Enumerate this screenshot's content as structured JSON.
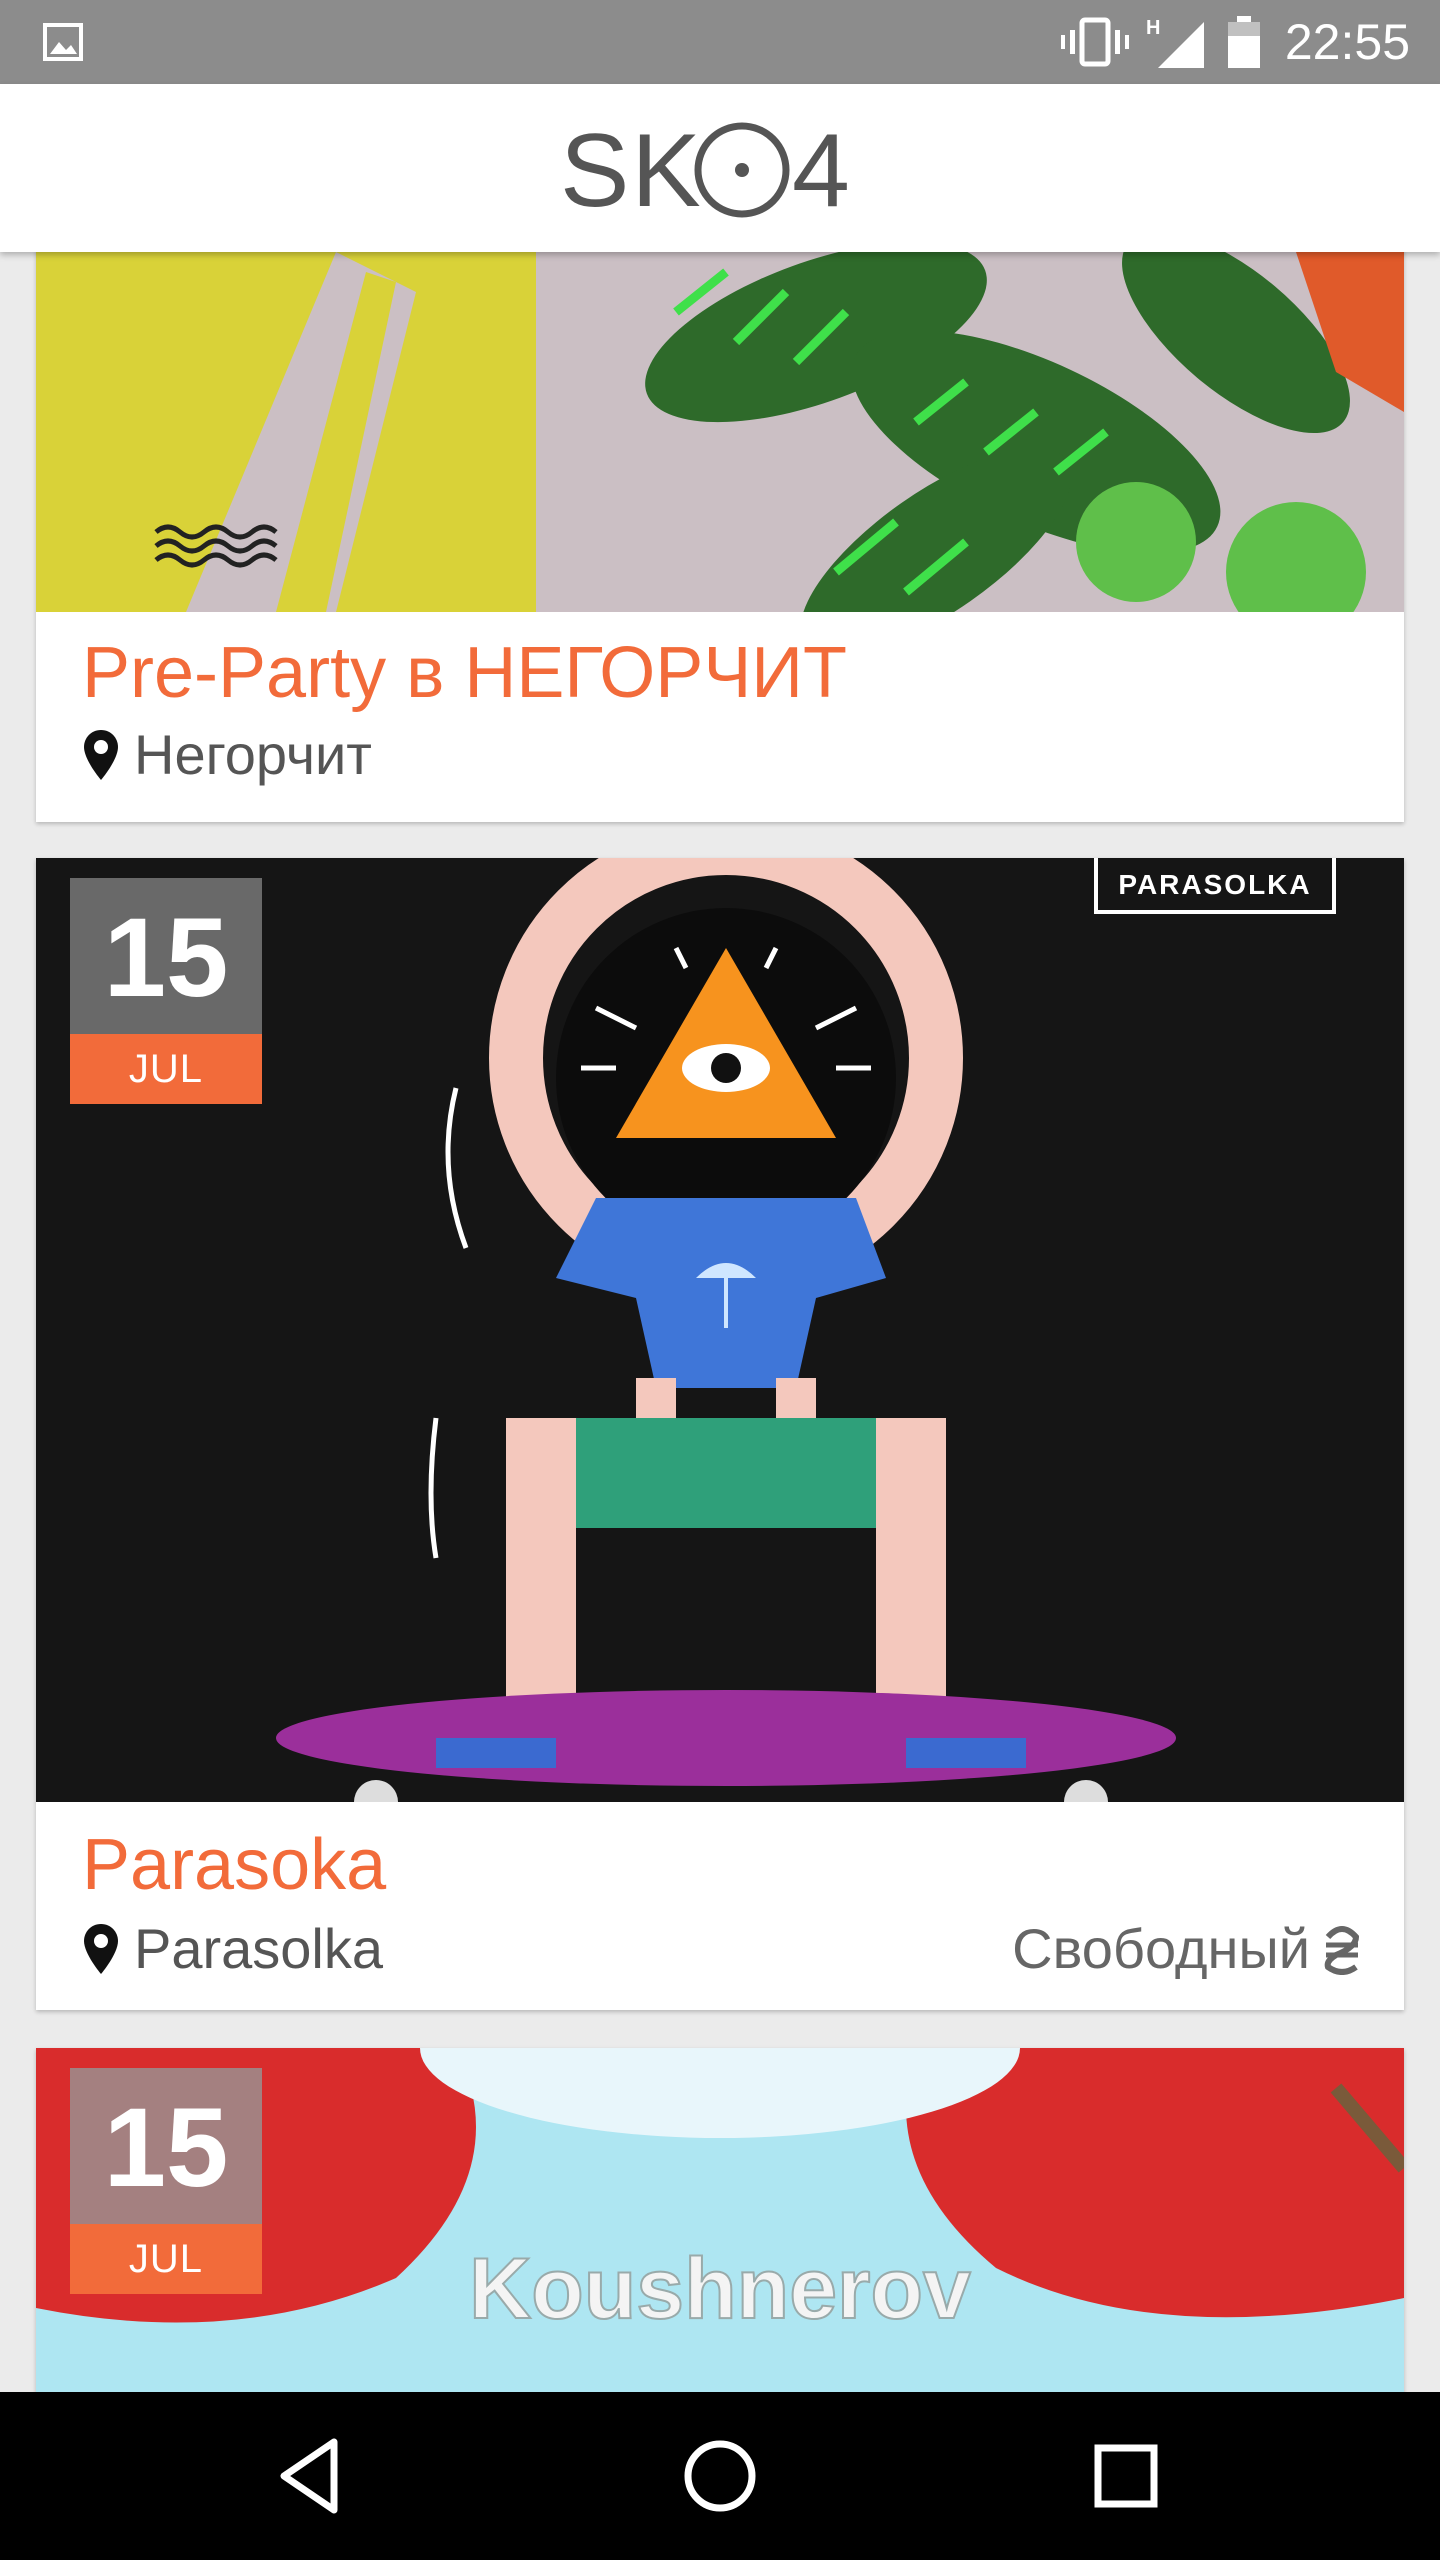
{
  "status_bar": {
    "time": "22:55",
    "network_label": "H",
    "icons": [
      "image-icon",
      "vibrate-icon",
      "signal-icon",
      "battery-icon"
    ]
  },
  "app_bar": {
    "logo_text": "SKO4"
  },
  "colors": {
    "accent": "#f26b3a",
    "status_bar": "#8c8c8c",
    "nav_bar": "#000000",
    "venue_text": "#555555"
  },
  "cards": [
    {
      "title": "Pre-Party в НЕГОРЧИТ",
      "venue": "Негорчит",
      "venue_icon": "location-pin-icon"
    },
    {
      "title": "Parasoka",
      "venue": "Parasolka",
      "venue_icon": "location-pin-icon",
      "price": "Свободный",
      "price_icon": "hryvnia-icon",
      "date": {
        "day": "15",
        "month": "JUL"
      },
      "poster_label": "PARASOLKA"
    },
    {
      "date": {
        "day": "15",
        "month": "JUL"
      },
      "poster_text": "Koushnerov"
    }
  ],
  "nav_bar": {
    "buttons": [
      "back-icon",
      "home-icon",
      "recents-icon"
    ]
  }
}
